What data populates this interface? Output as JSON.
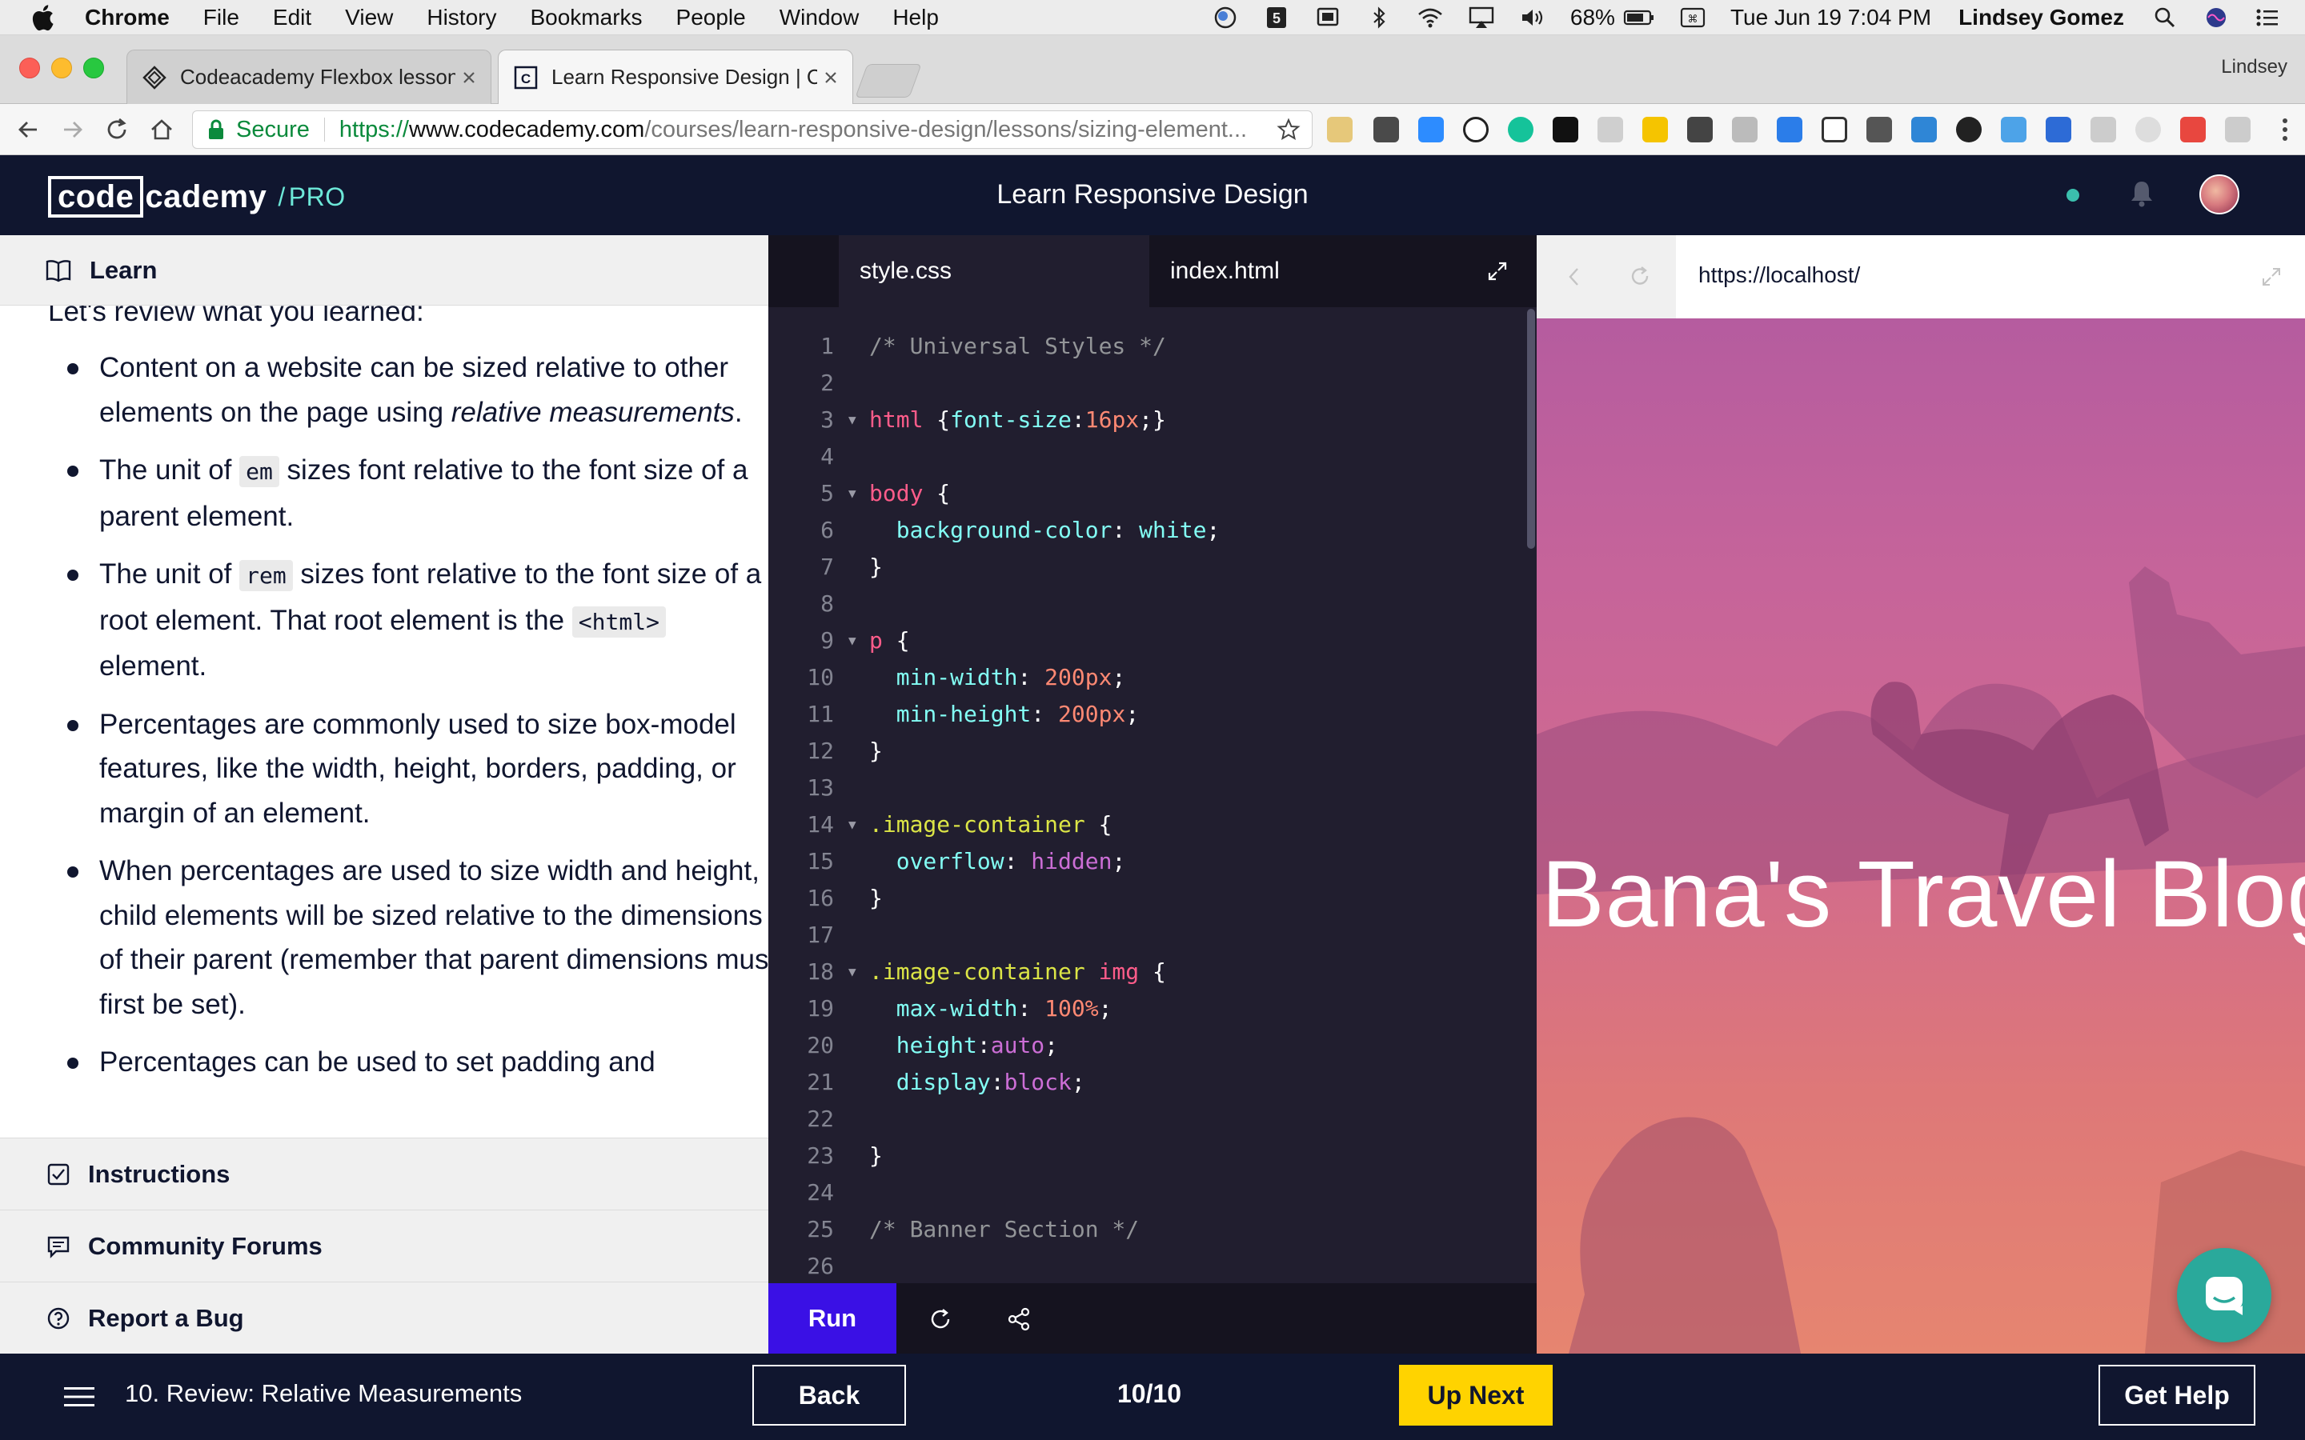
{
  "menubar": {
    "app_name": "Chrome",
    "menus": [
      "File",
      "Edit",
      "View",
      "History",
      "Bookmarks",
      "People",
      "Window",
      "Help"
    ],
    "battery": "68%",
    "datetime": "Tue Jun 19  7:04 PM",
    "user": "Lindsey Gomez"
  },
  "browser": {
    "tabs": [
      {
        "title": "Codeacademy Flexbox lesson",
        "active": false
      },
      {
        "title": "Learn Responsive Design | Codecademy",
        "active": true
      }
    ],
    "profile": "Lindsey",
    "secure_label": "Secure",
    "url_prefix": "https://",
    "url_domain": "www.codecademy.com",
    "url_path": "/courses/learn-responsive-design/lessons/sizing-element..."
  },
  "header": {
    "logo_boxed": "code",
    "logo_rest": "cademy",
    "logo_slash": "/",
    "logo_pro": "PRO",
    "course_title": "Learn Responsive Design"
  },
  "learn": {
    "title": "Learn",
    "cut_line": "Let's review what you learned:",
    "bullets": [
      {
        "pre": "Content on a website can be sized relative to other elements on the page using ",
        "em": "relative measurements",
        "post": "."
      },
      {
        "pre": "The unit of ",
        "code": "em",
        "post": " sizes font relative to the font size of a parent element."
      },
      {
        "pre": "The unit of ",
        "code": "rem",
        "post": " sizes font relative to the font size of a root element. That root element is the ",
        "code2": "<html>",
        "post2": " element."
      },
      {
        "text": "Percentages are commonly used to size box-model features, like the width, height, borders, padding, or margin of an element."
      },
      {
        "text": "When percentages are used to size width and height, child elements will be sized relative to the dimensions of their parent (remember that parent dimensions must first be set)."
      },
      {
        "text": "Percentages can be used to set padding and"
      }
    ],
    "sections": [
      "Instructions",
      "Community Forums",
      "Report a Bug"
    ]
  },
  "editor": {
    "tabs": [
      "style.css",
      "index.html"
    ],
    "code_lines": [
      {
        "n": "1",
        "fold": false,
        "tokens": [
          [
            "c-com",
            "/* Universal Styles */"
          ]
        ]
      },
      {
        "n": "2",
        "fold": false,
        "tokens": []
      },
      {
        "n": "3",
        "fold": true,
        "tokens": [
          [
            "c-sel",
            "html"
          ],
          [
            "",
            " {"
          ],
          [
            "c-prop",
            "font-size"
          ],
          [
            "",
            ":"
          ],
          [
            "c-num",
            "16px"
          ],
          [
            "",
            ";}"
          ]
        ]
      },
      {
        "n": "4",
        "fold": false,
        "tokens": []
      },
      {
        "n": "5",
        "fold": true,
        "tokens": [
          [
            "c-sel",
            "body"
          ],
          [
            "",
            " {"
          ]
        ]
      },
      {
        "n": "6",
        "fold": false,
        "tokens": [
          [
            "",
            "  "
          ],
          [
            "c-prop",
            "background-color"
          ],
          [
            "",
            ": "
          ],
          [
            "c-prop",
            "white"
          ],
          [
            "",
            ";"
          ]
        ]
      },
      {
        "n": "7",
        "fold": false,
        "tokens": [
          [
            "",
            "}"
          ]
        ]
      },
      {
        "n": "8",
        "fold": false,
        "tokens": []
      },
      {
        "n": "9",
        "fold": true,
        "tokens": [
          [
            "c-sel",
            "p"
          ],
          [
            "",
            " {"
          ]
        ]
      },
      {
        "n": "10",
        "fold": false,
        "tokens": [
          [
            "",
            "  "
          ],
          [
            "c-prop",
            "min-width"
          ],
          [
            "",
            ": "
          ],
          [
            "c-num",
            "200px"
          ],
          [
            "",
            ";"
          ]
        ]
      },
      {
        "n": "11",
        "fold": false,
        "tokens": [
          [
            "",
            "  "
          ],
          [
            "c-prop",
            "min-height"
          ],
          [
            "",
            ": "
          ],
          [
            "c-num",
            "200px"
          ],
          [
            "",
            ";"
          ]
        ]
      },
      {
        "n": "12",
        "fold": false,
        "tokens": [
          [
            "",
            "}"
          ]
        ]
      },
      {
        "n": "13",
        "fold": false,
        "tokens": []
      },
      {
        "n": "14",
        "fold": true,
        "tokens": [
          [
            "c-cls",
            ".image-container"
          ],
          [
            "",
            " {"
          ]
        ]
      },
      {
        "n": "15",
        "fold": false,
        "tokens": [
          [
            "",
            "  "
          ],
          [
            "c-prop",
            "overflow"
          ],
          [
            "",
            ": "
          ],
          [
            "c-kw",
            "hidden"
          ],
          [
            "",
            ";"
          ]
        ]
      },
      {
        "n": "16",
        "fold": false,
        "tokens": [
          [
            "",
            "}"
          ]
        ]
      },
      {
        "n": "17",
        "fold": false,
        "tokens": []
      },
      {
        "n": "18",
        "fold": true,
        "tokens": [
          [
            "c-cls",
            ".image-container"
          ],
          [
            "",
            " "
          ],
          [
            "c-sel",
            "img"
          ],
          [
            "",
            " {"
          ]
        ]
      },
      {
        "n": "19",
        "fold": false,
        "tokens": [
          [
            "",
            "  "
          ],
          [
            "c-prop",
            "max-width"
          ],
          [
            "",
            ": "
          ],
          [
            "c-num",
            "100%"
          ],
          [
            "",
            ";"
          ]
        ]
      },
      {
        "n": "20",
        "fold": false,
        "tokens": [
          [
            "",
            "  "
          ],
          [
            "c-prop",
            "height"
          ],
          [
            "",
            ":"
          ],
          [
            "c-kw",
            "auto"
          ],
          [
            "",
            ";"
          ]
        ]
      },
      {
        "n": "21",
        "fold": false,
        "tokens": [
          [
            "",
            "  "
          ],
          [
            "c-prop",
            "display"
          ],
          [
            "",
            ":"
          ],
          [
            "c-kw",
            "block"
          ],
          [
            "",
            ";"
          ]
        ]
      },
      {
        "n": "22",
        "fold": false,
        "tokens": []
      },
      {
        "n": "23",
        "fold": false,
        "tokens": [
          [
            "",
            "}"
          ]
        ]
      },
      {
        "n": "24",
        "fold": false,
        "tokens": []
      },
      {
        "n": "25",
        "fold": false,
        "tokens": [
          [
            "c-com",
            "/* Banner Section */"
          ]
        ]
      },
      {
        "n": "26",
        "fold": false,
        "tokens": []
      }
    ],
    "run_label": "Run"
  },
  "preview": {
    "url": "https://localhost/",
    "blog_title": "Bana's Travel Blog"
  },
  "footer": {
    "lesson_name": "10. Review: Relative Measurements",
    "back_label": "Back",
    "progress": "10/10",
    "next_label": "Up Next",
    "help_label": "Get Help"
  },
  "colors": {
    "navy": "#10162f",
    "editor_bg": "#211e2f",
    "run_blue": "#3a10e5",
    "next_yellow": "#ffd300",
    "pro_teal": "#6de8d8",
    "chat_teal": "#2aa99b"
  }
}
